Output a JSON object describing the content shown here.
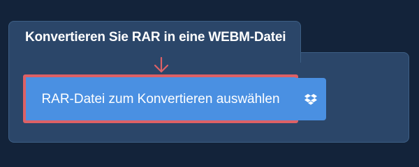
{
  "converter": {
    "title": "Konvertieren Sie RAR in eine WEBM-Datei",
    "select_file_label": "RAR-Datei zum Konvertieren auswählen"
  },
  "icons": {
    "arrow": "arrow-down-icon",
    "dropbox": "dropbox-icon"
  },
  "colors": {
    "background": "#13233a",
    "panel": "#2b4669",
    "button": "#4a90e2",
    "highlight": "#dd6166"
  }
}
